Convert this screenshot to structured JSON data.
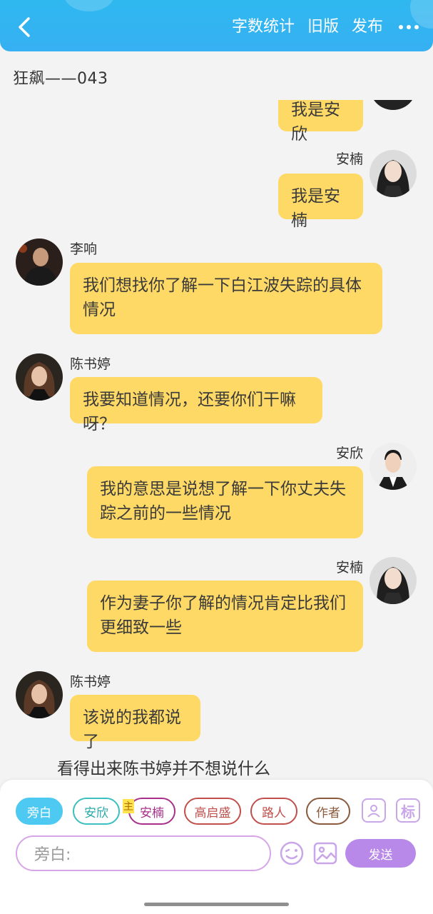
{
  "header": {
    "word_count": "字数统计",
    "old_version": "旧版",
    "publish": "发布"
  },
  "chapter_title": "狂飙——043",
  "messages": {
    "m0_text": "我是安欣",
    "m1_name": "安楠",
    "m1_text": "我是安楠",
    "m2_name": "李响",
    "m2_text": "我们想找你了解一下白江波失踪的具体情况",
    "m3_name": "陈书婷",
    "m3_text": "我要知道情况，还要你们干嘛呀？",
    "m4_name": "安欣",
    "m4_text": "我的意思是说想了解一下你丈夫失踪之前的一些情况",
    "m5_name": "安楠",
    "m5_text": "作为妻子你了解的情况肯定比我们更细致一些",
    "m6_name": "陈书婷",
    "m6_text": "该说的我都说了",
    "narration": "看得出来陈书婷并不想说什么"
  },
  "roles": {
    "narration": "旁白",
    "anxin": "安欣",
    "annan": "安楠",
    "annan_mark": "主",
    "gaoqisheng": "高启盛",
    "passerby": "路人",
    "author": "作者"
  },
  "icons": {
    "tag": "标"
  },
  "input": {
    "value": "旁白:"
  },
  "send_label": "发送",
  "colors": {
    "header_blue": "#2fb8f0",
    "bubble_yellow": "#ffd966",
    "send_purple": "#b889e8",
    "chip_teal": "#3bbfbf",
    "chip_purple": "#a8308a",
    "chip_red": "#c0504d",
    "chip_brown": "#8b5a3c"
  }
}
